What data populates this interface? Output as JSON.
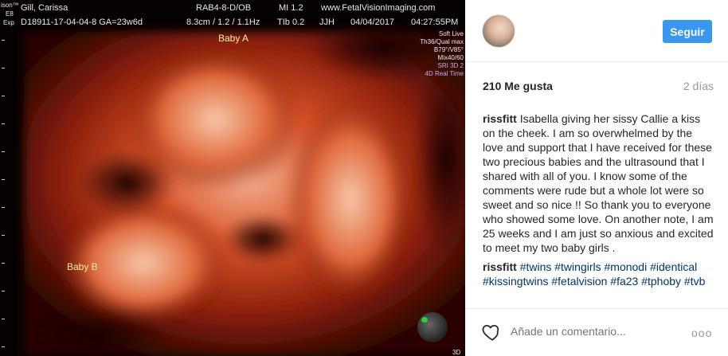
{
  "scan": {
    "patient_name": "Gill, Carissa",
    "side_top": "ison™",
    "side_e8": "E8",
    "side_exp": "Exp",
    "probe": "RAB4-8-D/OB",
    "mi": "MI  1.2",
    "website": "www.FetalVisionImaging.com",
    "id_line": "D18911-17-04-04-8  GA=23w6d",
    "params": "8.3cm / 1.2 / 1.1Hz",
    "tib": "TIb  0.2",
    "operator": "JJH",
    "date": "04/04/2017",
    "time": "04:27:55PM",
    "right_info": [
      "Soft Live",
      "Th36/Qual max",
      "B79°/V85°",
      "Mix40/60",
      "SRI 3D 2",
      "4D Real Time"
    ],
    "baby_a": "Baby A",
    "baby_b": "Baby B",
    "bottom_mark": "3D"
  },
  "post": {
    "follow_label": "Seguir",
    "likes": "210 Me gusta",
    "time_ago": "2 días",
    "caption_user": "rissfitt",
    "caption_text": "Isabella giving her sissy Callie a kiss on the cheek. I am so overwhelmed by the love and support that I have received for these two precious babies and the ultrasound that I shared with all of you. I know some of the comments were rude but a whole lot were so sweet and so nice !! So thank you to everyone who showed some love. On another note, I am 25 weeks and I am just so anxious and excited to meet my two baby girls .",
    "tags_user": "rissfitt",
    "tags": "#twins #twingirls #monodi #identical #kissingtwins #fetalvision #fa23 #tphoby #tvb",
    "comment_placeholder": "Añade un comentario...",
    "more_label": "ooo"
  },
  "icons": [
    "avatar",
    "heart-icon",
    "more-options-icon"
  ],
  "colors": {
    "follow": "#3897f0",
    "hashtag": "#003569",
    "muted": "#999999"
  }
}
